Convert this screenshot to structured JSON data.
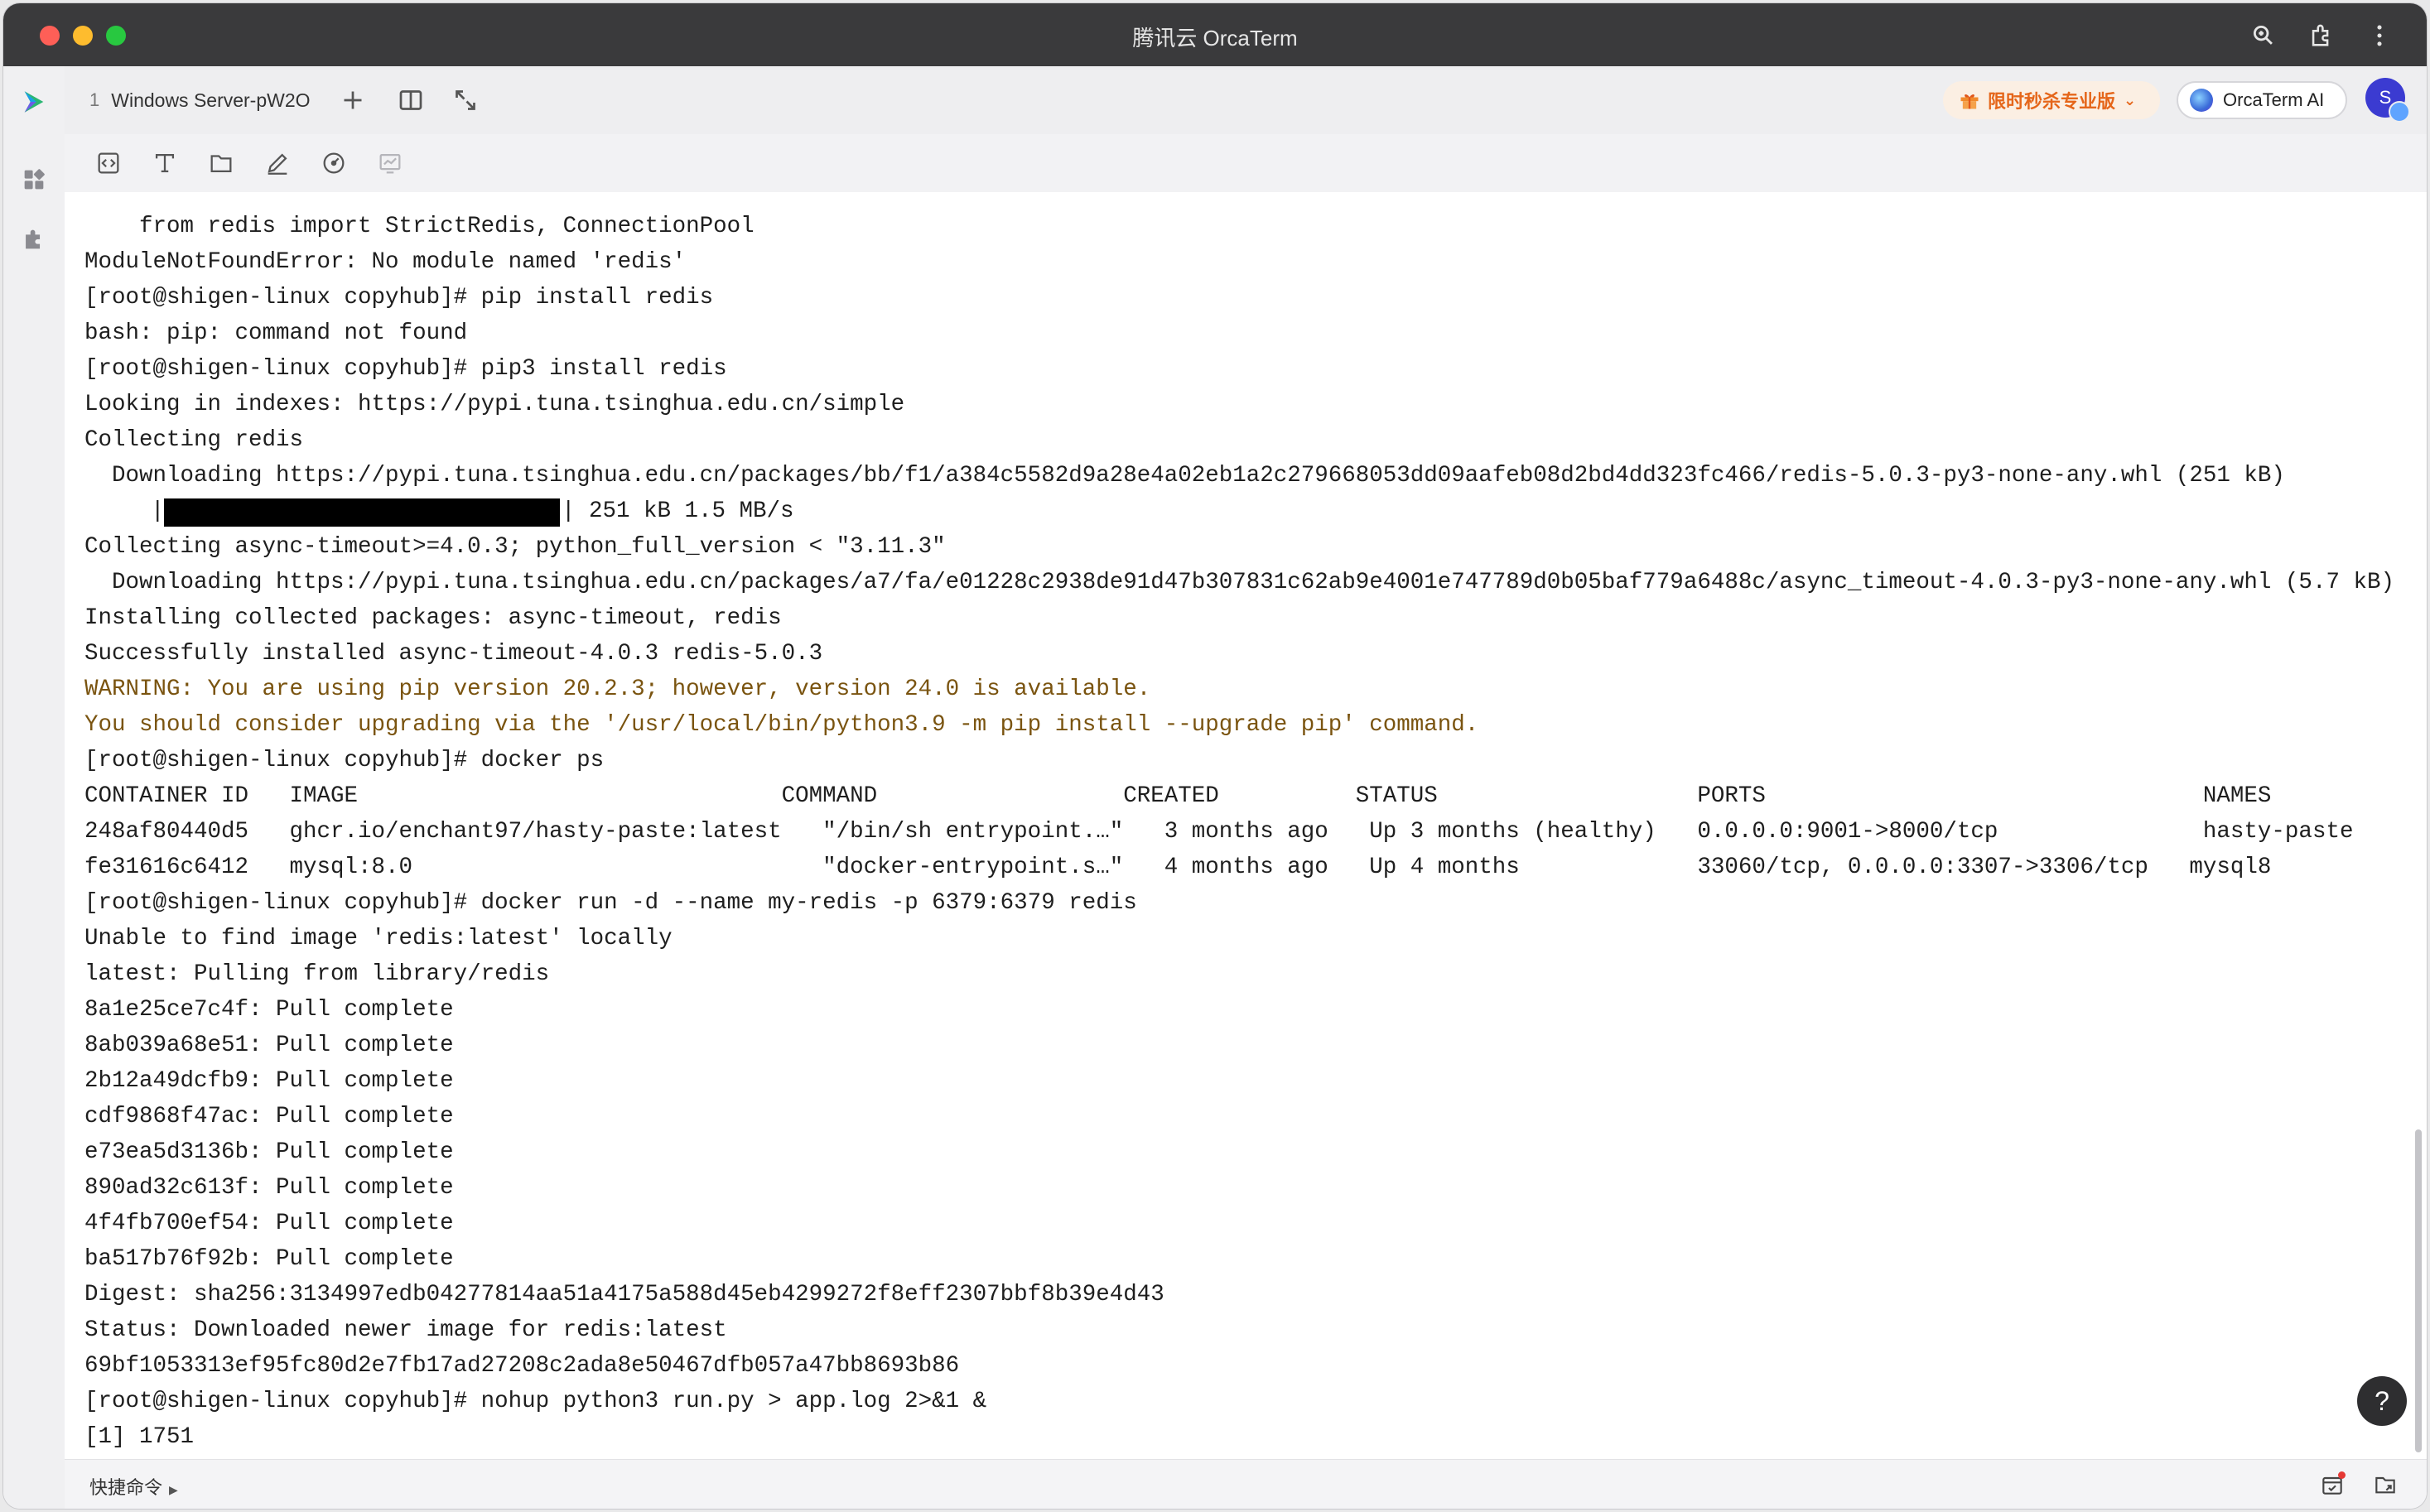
{
  "window": {
    "title": "腾讯云 OrcaTerm"
  },
  "tabs": [
    {
      "index": "1",
      "label": "Windows Server-pW2O"
    }
  ],
  "promo": {
    "label": "限时秒杀专业版"
  },
  "ai_button": {
    "label": "OrcaTerm AI"
  },
  "user": {
    "avatar_initial": "S"
  },
  "terminal": {
    "lines": [
      {
        "text": "    from redis import StrictRedis, ConnectionPool",
        "style": "normal"
      },
      {
        "text": "ModuleNotFoundError: No module named 'redis'",
        "style": "normal"
      },
      {
        "text": "[root@shigen-linux copyhub]# pip install redis",
        "style": "normal"
      },
      {
        "text": "bash: pip: command not found",
        "style": "normal"
      },
      {
        "text": "[root@shigen-linux copyhub]# pip3 install redis",
        "style": "normal"
      },
      {
        "text": "Looking in indexes: https://pypi.tuna.tsinghua.edu.cn/simple",
        "style": "normal"
      },
      {
        "text": "Collecting redis",
        "style": "normal"
      },
      {
        "text": "  Downloading https://pypi.tuna.tsinghua.edu.cn/packages/bb/f1/a384c5582d9a28e4a02eb1a2c279668053dd09aafeb08d2bd4dd323fc466/redis-5.0.3-py3-none-any.whl (251 kB)",
        "style": "normal"
      },
      {
        "text": "",
        "style": "progress"
      },
      {
        "text": "Collecting async-timeout>=4.0.3; python_full_version < \"3.11.3\"",
        "style": "normal"
      },
      {
        "text": "  Downloading https://pypi.tuna.tsinghua.edu.cn/packages/a7/fa/e01228c2938de91d47b307831c62ab9e4001e747789d0b05baf779a6488c/async_timeout-4.0.3-py3-none-any.whl (5.7 kB)",
        "style": "normal"
      },
      {
        "text": "Installing collected packages: async-timeout, redis",
        "style": "normal"
      },
      {
        "text": "Successfully installed async-timeout-4.0.3 redis-5.0.3",
        "style": "normal"
      },
      {
        "text": "WARNING: You are using pip version 20.2.3; however, version 24.0 is available.",
        "style": "warn"
      },
      {
        "text": "You should consider upgrading via the '/usr/local/bin/python3.9 -m pip install --upgrade pip' command.",
        "style": "warn"
      },
      {
        "text": "[root@shigen-linux copyhub]# docker ps",
        "style": "normal"
      },
      {
        "text": "CONTAINER ID   IMAGE                               COMMAND                  CREATED          STATUS                   PORTS                                NAMES",
        "style": "normal"
      },
      {
        "text": "248af80440d5   ghcr.io/enchant97/hasty-paste:latest   \"/bin/sh entrypoint.…\"   3 months ago   Up 3 months (healthy)   0.0.0.0:9001->8000/tcp               hasty-paste",
        "style": "normal"
      },
      {
        "text": "fe31616c6412   mysql:8.0                              \"docker-entrypoint.s…\"   4 months ago   Up 4 months             33060/tcp, 0.0.0.0:3307->3306/tcp   mysql8",
        "style": "normal"
      },
      {
        "text": "[root@shigen-linux copyhub]# docker run -d --name my-redis -p 6379:6379 redis",
        "style": "normal"
      },
      {
        "text": "Unable to find image 'redis:latest' locally",
        "style": "normal"
      },
      {
        "text": "latest: Pulling from library/redis",
        "style": "normal"
      },
      {
        "text": "8a1e25ce7c4f: Pull complete",
        "style": "normal"
      },
      {
        "text": "8ab039a68e51: Pull complete",
        "style": "normal"
      },
      {
        "text": "2b12a49dcfb9: Pull complete",
        "style": "normal"
      },
      {
        "text": "cdf9868f47ac: Pull complete",
        "style": "normal"
      },
      {
        "text": "e73ea5d3136b: Pull complete",
        "style": "normal"
      },
      {
        "text": "890ad32c613f: Pull complete",
        "style": "normal"
      },
      {
        "text": "4f4fb700ef54: Pull complete",
        "style": "normal"
      },
      {
        "text": "ba517b76f92b: Pull complete",
        "style": "normal"
      },
      {
        "text": "Digest: sha256:3134997edb04277814aa51a4175a588d45eb4299272f8eff2307bbf8b39e4d43",
        "style": "normal"
      },
      {
        "text": "Status: Downloaded newer image for redis:latest",
        "style": "normal"
      },
      {
        "text": "69bf1053313ef95fc80d2e7fb17ad27208c2ada8e50467dfb057a47bb8693b86",
        "style": "normal"
      },
      {
        "text": "[root@shigen-linux copyhub]# nohup python3 run.py > app.log 2>&1 &",
        "style": "normal"
      },
      {
        "text": "[1] 1751",
        "style": "normal"
      }
    ],
    "progress": {
      "pipe_left": "|",
      "suffix": "| 251 kB 1.5 MB/s",
      "fraction": 1.0
    }
  },
  "help": {
    "label": "?"
  },
  "bottombar": {
    "quick_commands_label": "快捷命令"
  }
}
